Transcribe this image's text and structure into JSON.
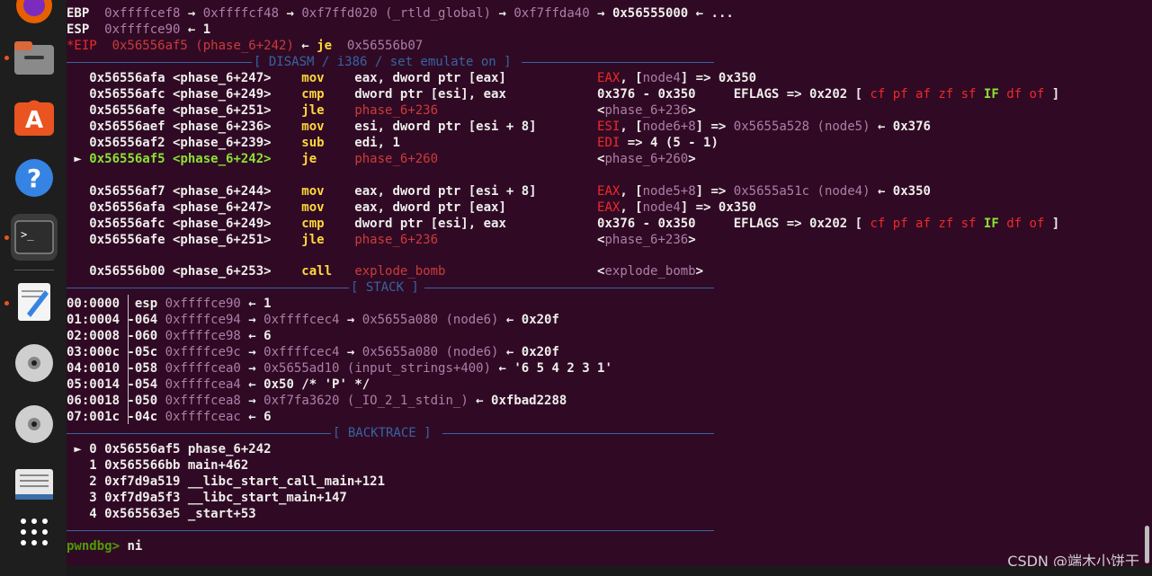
{
  "colors": {
    "default": "#eeeeec",
    "yellow": "#ffd83a",
    "purple": "#ad7fa8",
    "red": "#ef2929",
    "darkred": "#cc3b3b",
    "green": "#4e9a06",
    "lightgreen": "#8ae234",
    "blue": "#729fcf",
    "sepblue": "#3465a4",
    "grey": "#d3d7cf"
  },
  "dock": {
    "apps": [
      {
        "name": "firefox-icon"
      },
      {
        "name": "files-icon"
      },
      {
        "name": "software-store-icon"
      },
      {
        "name": "help-icon"
      },
      {
        "name": "terminal-icon"
      },
      {
        "name": "text-editor-icon"
      },
      {
        "name": "disc-icon"
      },
      {
        "name": "disc-icon-2"
      },
      {
        "name": "save-file-icon"
      },
      {
        "name": "show-apps-icon"
      }
    ]
  },
  "registers": [
    {
      "name": "reg-ebp",
      "segs": [
        [
          "default",
          "EBP  "
        ],
        [
          "purple",
          "0xffffcef8"
        ],
        [
          "default",
          " → "
        ],
        [
          "purple",
          "0xffffcf48"
        ],
        [
          "default",
          " → "
        ],
        [
          "purple",
          "0xf7ffd020 (_rtld_global)"
        ],
        [
          "default",
          " → "
        ],
        [
          "purple",
          "0xf7ffda40"
        ],
        [
          "default",
          " → 0x56555000 ← ..."
        ]
      ]
    },
    {
      "name": "reg-esp",
      "segs": [
        [
          "default",
          "ESP  "
        ],
        [
          "purple",
          "0xffffce90"
        ],
        [
          "default",
          " ← 1"
        ]
      ]
    },
    {
      "name": "reg-eip",
      "segs": [
        [
          "red",
          "*EIP  "
        ],
        [
          "darkred",
          "0x56556af5 (phase_6+242)"
        ],
        [
          "default",
          " ← "
        ],
        [
          "yellow",
          "je"
        ],
        [
          "default",
          "  "
        ],
        [
          "purple",
          "0x56556b07"
        ]
      ]
    }
  ],
  "disasm_title": "[ DISASM / i386 / set emulate on ]",
  "disasm": [
    {
      "name": "disasm-line-1",
      "segs": [
        [
          "default",
          "   0x56556afa <phase_6+247>    "
        ],
        [
          "yellow",
          "mov"
        ],
        [
          "default",
          "    eax, dword ptr [eax]            "
        ],
        [
          "red",
          "EAX"
        ],
        [
          "default",
          ", ["
        ],
        [
          "purple",
          "node4"
        ],
        [
          "default",
          "] => 0x350"
        ]
      ]
    },
    {
      "name": "disasm-line-2",
      "segs": [
        [
          "default",
          "   0x56556afc <phase_6+249>    "
        ],
        [
          "yellow",
          "cmp"
        ],
        [
          "default",
          "    dword ptr [esi], eax            0x376 - 0x350     EFLAGS => 0x202 [ "
        ],
        [
          "red",
          "cf pf af zf sf"
        ],
        [
          "default",
          " "
        ],
        [
          "lightgreen",
          "IF"
        ],
        [
          "default",
          " "
        ],
        [
          "red",
          "df of"
        ],
        [
          "default",
          " ]"
        ]
      ]
    },
    {
      "name": "disasm-line-3",
      "segs": [
        [
          "default",
          "   0x56556afe <phase_6+251>    "
        ],
        [
          "yellow",
          "jle"
        ],
        [
          "default",
          "    "
        ],
        [
          "darkred",
          "phase_6+236"
        ],
        [
          "default",
          "                     <"
        ],
        [
          "purple",
          "phase_6+236"
        ],
        [
          "default",
          ">"
        ]
      ]
    },
    {
      "name": "disasm-line-4",
      "segs": [
        [
          "default",
          "   0x56556aef <phase_6+236>    "
        ],
        [
          "yellow",
          "mov"
        ],
        [
          "default",
          "    esi, dword ptr [esi + 8]        "
        ],
        [
          "red",
          "ESI"
        ],
        [
          "default",
          ", ["
        ],
        [
          "purple",
          "node6+8"
        ],
        [
          "default",
          "] => "
        ],
        [
          "purple",
          "0x5655a528 (node5)"
        ],
        [
          "default",
          " ← 0x376"
        ]
      ]
    },
    {
      "name": "disasm-line-5",
      "segs": [
        [
          "default",
          "   0x56556af2 <phase_6+239>    "
        ],
        [
          "yellow",
          "sub"
        ],
        [
          "default",
          "    edi, 1                          "
        ],
        [
          "red",
          "EDI"
        ],
        [
          "default",
          " => 4 (5 - 1)"
        ]
      ]
    },
    {
      "name": "disasm-line-current",
      "segs": [
        [
          "default",
          " ► "
        ],
        [
          "lightgreen",
          "0x56556af5 <phase_6+242>    "
        ],
        [
          "yellow",
          "je"
        ],
        [
          "default",
          "     "
        ],
        [
          "darkred",
          "phase_6+260"
        ],
        [
          "default",
          "                     <"
        ],
        [
          "purple",
          "phase_6+260"
        ],
        [
          "default",
          ">"
        ]
      ]
    },
    {
      "name": "disasm-blank-1",
      "segs": [
        [
          "default",
          " "
        ]
      ]
    },
    {
      "name": "disasm-line-7",
      "segs": [
        [
          "default",
          "   0x56556af7 <phase_6+244>    "
        ],
        [
          "yellow",
          "mov"
        ],
        [
          "default",
          "    eax, dword ptr [esi + 8]        "
        ],
        [
          "red",
          "EAX"
        ],
        [
          "default",
          ", ["
        ],
        [
          "purple",
          "node5+8"
        ],
        [
          "default",
          "] => "
        ],
        [
          "purple",
          "0x5655a51c (node4)"
        ],
        [
          "default",
          " ← 0x350"
        ]
      ]
    },
    {
      "name": "disasm-line-8",
      "segs": [
        [
          "default",
          "   0x56556afa <phase_6+247>    "
        ],
        [
          "yellow",
          "mov"
        ],
        [
          "default",
          "    eax, dword ptr [eax]            "
        ],
        [
          "red",
          "EAX"
        ],
        [
          "default",
          ", ["
        ],
        [
          "purple",
          "node4"
        ],
        [
          "default",
          "] => 0x350"
        ]
      ]
    },
    {
      "name": "disasm-line-9",
      "segs": [
        [
          "default",
          "   0x56556afc <phase_6+249>    "
        ],
        [
          "yellow",
          "cmp"
        ],
        [
          "default",
          "    dword ptr [esi], eax            0x376 - 0x350     EFLAGS => 0x202 [ "
        ],
        [
          "red",
          "cf pf af zf sf"
        ],
        [
          "default",
          " "
        ],
        [
          "lightgreen",
          "IF"
        ],
        [
          "default",
          " "
        ],
        [
          "red",
          "df of"
        ],
        [
          "default",
          " ]"
        ]
      ]
    },
    {
      "name": "disasm-line-10",
      "segs": [
        [
          "default",
          "   0x56556afe <phase_6+251>    "
        ],
        [
          "yellow",
          "jle"
        ],
        [
          "default",
          "    "
        ],
        [
          "darkred",
          "phase_6+236"
        ],
        [
          "default",
          "                     <"
        ],
        [
          "purple",
          "phase_6+236"
        ],
        [
          "default",
          ">"
        ]
      ]
    },
    {
      "name": "disasm-blank-2",
      "segs": [
        [
          "default",
          " "
        ]
      ]
    },
    {
      "name": "disasm-line-12",
      "segs": [
        [
          "default",
          "   0x56556b00 <phase_6+253>    "
        ],
        [
          "yellow",
          "call"
        ],
        [
          "default",
          "   "
        ],
        [
          "darkred",
          "explode_bomb"
        ],
        [
          "default",
          "                    <"
        ],
        [
          "purple",
          "explode_bomb"
        ],
        [
          "default",
          ">"
        ]
      ]
    }
  ],
  "stack_title": "[ STACK ]",
  "stack": [
    {
      "name": "stack-row-0",
      "segs": [
        [
          "default",
          "00:0000  esp "
        ],
        [
          "purple",
          "0xffffce90"
        ],
        [
          "default",
          " ← 1"
        ]
      ]
    },
    {
      "name": "stack-row-1",
      "segs": [
        [
          "default",
          "01:0004 -064 "
        ],
        [
          "purple",
          "0xffffce94"
        ],
        [
          "default",
          " → "
        ],
        [
          "purple",
          "0xffffcec4"
        ],
        [
          "default",
          " → "
        ],
        [
          "purple",
          "0x5655a080 (node6)"
        ],
        [
          "default",
          " ← 0x20f"
        ]
      ]
    },
    {
      "name": "stack-row-2",
      "segs": [
        [
          "default",
          "02:0008 -060 "
        ],
        [
          "purple",
          "0xffffce98"
        ],
        [
          "default",
          " ← 6"
        ]
      ]
    },
    {
      "name": "stack-row-3",
      "segs": [
        [
          "default",
          "03:000c -05c "
        ],
        [
          "purple",
          "0xffffce9c"
        ],
        [
          "default",
          " → "
        ],
        [
          "purple",
          "0xffffcec4"
        ],
        [
          "default",
          " → "
        ],
        [
          "purple",
          "0x5655a080 (node6)"
        ],
        [
          "default",
          " ← 0x20f"
        ]
      ]
    },
    {
      "name": "stack-row-4",
      "segs": [
        [
          "default",
          "04:0010 -058 "
        ],
        [
          "purple",
          "0xffffcea0"
        ],
        [
          "default",
          " → "
        ],
        [
          "purple",
          "0x5655ad10 (input_strings+400)"
        ],
        [
          "default",
          " ← '6 5 4 2 3 1'"
        ]
      ]
    },
    {
      "name": "stack-row-5",
      "segs": [
        [
          "default",
          "05:0014 -054 "
        ],
        [
          "purple",
          "0xffffcea4"
        ],
        [
          "default",
          " ← 0x50 /* 'P' */"
        ]
      ]
    },
    {
      "name": "stack-row-6",
      "segs": [
        [
          "default",
          "06:0018 -050 "
        ],
        [
          "purple",
          "0xffffcea8"
        ],
        [
          "default",
          " → "
        ],
        [
          "purple",
          "0xf7fa3620 (_IO_2_1_stdin_)"
        ],
        [
          "default",
          " ← 0xfbad2288"
        ]
      ]
    },
    {
      "name": "stack-row-7",
      "segs": [
        [
          "default",
          "07:001c -04c "
        ],
        [
          "purple",
          "0xffffceac"
        ],
        [
          "default",
          " ← 6"
        ]
      ]
    }
  ],
  "backtrace_title": "[ BACKTRACE ]",
  "backtrace": [
    {
      "name": "backtrace-frame-0",
      "segs": [
        [
          "default",
          " ► 0 0x56556af5 phase_6+242"
        ]
      ]
    },
    {
      "name": "backtrace-frame-1",
      "segs": [
        [
          "default",
          "   1 0x565566bb main+462"
        ]
      ]
    },
    {
      "name": "backtrace-frame-2",
      "segs": [
        [
          "default",
          "   2 0xf7d9a519 __libc_start_call_main+121"
        ]
      ]
    },
    {
      "name": "backtrace-frame-3",
      "segs": [
        [
          "default",
          "   3 0xf7d9a5f3 __libc_start_main+147"
        ]
      ]
    },
    {
      "name": "backtrace-frame-4",
      "segs": [
        [
          "default",
          "   4 0x565563e5 _start+53"
        ]
      ]
    }
  ],
  "prompt": {
    "text": "pwndbg>",
    "command": " ni"
  },
  "watermark": "CSDN @端木小饼干"
}
